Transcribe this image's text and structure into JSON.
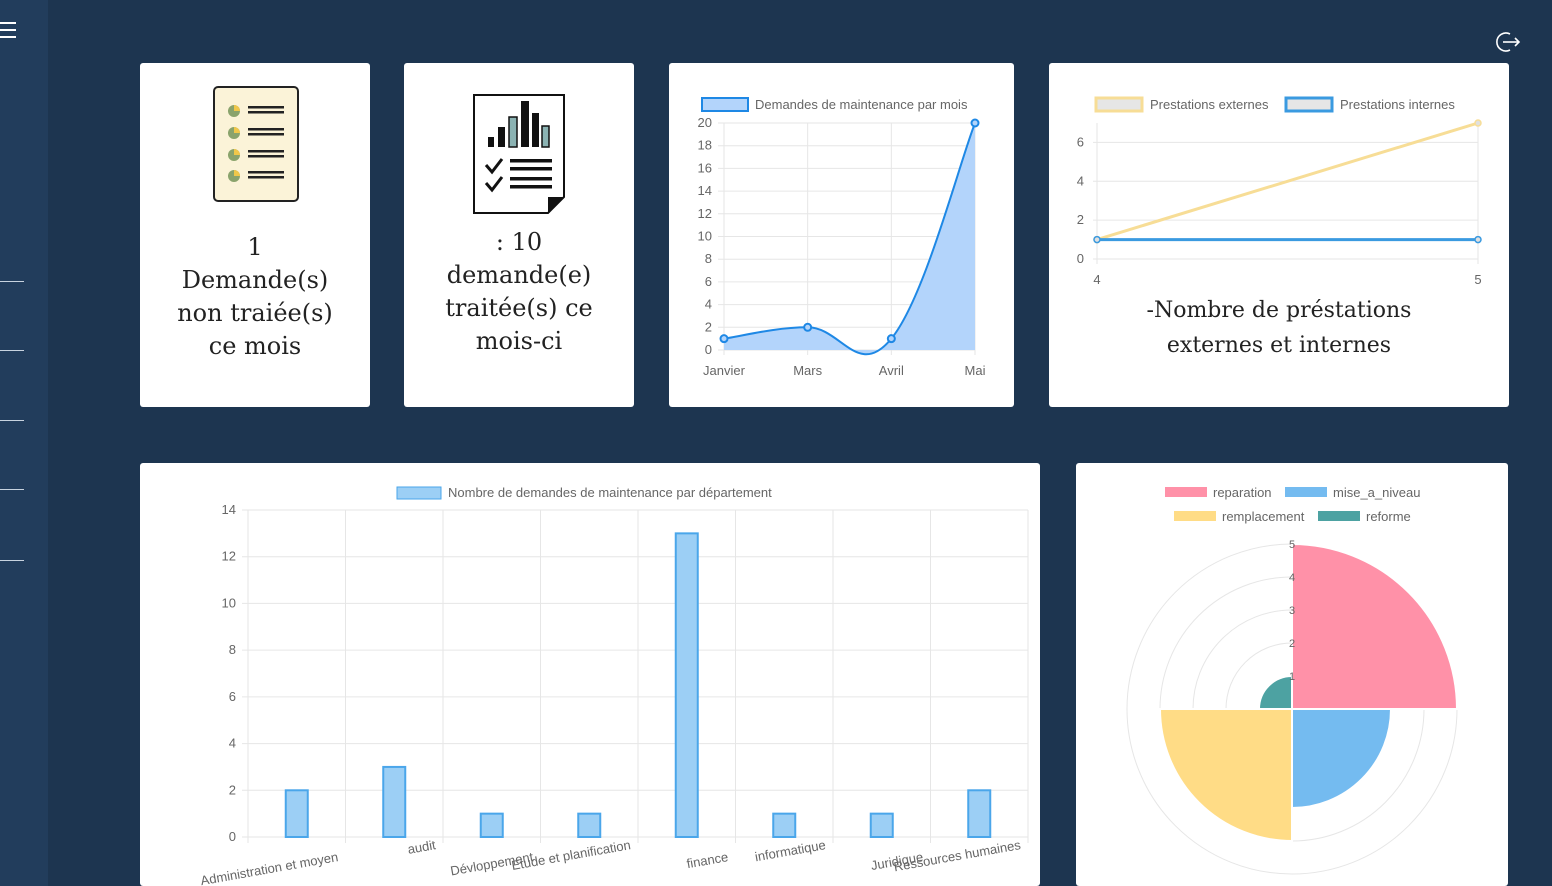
{
  "sidebar": {
    "menu_icon": "hamburger-menu-icon"
  },
  "header": {
    "logout_icon": "logout-icon"
  },
  "cards": {
    "untreated": {
      "icon": "checklist-document-icon",
      "count": "1",
      "line1": "Demande(s)",
      "line2": "non traiée(s)",
      "line3": "ce mois"
    },
    "treated": {
      "icon": "report-chart-document-icon",
      "count": ": 10",
      "line1": "demande(e)",
      "line2": "traitée(s) ce",
      "line3": "mois-ci"
    }
  },
  "prestations_caption": {
    "line1": "-Nombre de préstations",
    "line2": "externes et internes"
  },
  "chart_data": [
    {
      "type": "area",
      "categories": [
        "Janvier",
        "Mars",
        "Avril",
        "Mai"
      ],
      "series": [
        {
          "name": "Demandes de maintenance par mois",
          "values": [
            1,
            2,
            1,
            20
          ]
        }
      ],
      "ylim": [
        0,
        20
      ],
      "yticks": [
        0,
        2,
        4,
        6,
        8,
        10,
        12,
        14,
        16,
        18,
        20
      ],
      "grid": true,
      "legend": "top",
      "colors": {
        "line": "#1e88e5",
        "fill": "#b3d4fb"
      }
    },
    {
      "type": "line",
      "x": [
        4,
        5
      ],
      "series": [
        {
          "name": "Prestations externes",
          "values": [
            1,
            7
          ],
          "color": "#f7dd96"
        },
        {
          "name": "Prestations internes",
          "values": [
            1,
            1
          ],
          "color": "#3a9ae0"
        }
      ],
      "ylim": [
        0,
        7
      ],
      "yticks": [
        0,
        2,
        4,
        6
      ],
      "grid": true,
      "legend": "top"
    },
    {
      "type": "bar",
      "categories": [
        "Administration et moyen",
        "audit",
        "Dévloppement",
        "Etude et planification",
        "finance",
        "informatique",
        "Juridique",
        "Ressources humaines"
      ],
      "series": [
        {
          "name": "Nombre de demandes de maintenance par département",
          "values": [
            2,
            3,
            1,
            1,
            13,
            1,
            1,
            2
          ]
        }
      ],
      "ylim": [
        0,
        14
      ],
      "yticks": [
        0,
        2,
        4,
        6,
        8,
        10,
        12,
        14
      ],
      "grid": true,
      "legend": "top",
      "colors": {
        "fill": "#9ccff5",
        "stroke": "#4aa6ea"
      }
    },
    {
      "type": "polarArea",
      "categories": [
        "reparation",
        "mise_a_niveau",
        "remplacement",
        "reforme"
      ],
      "values": [
        5,
        3,
        4,
        1
      ],
      "rlim": [
        0,
        5
      ],
      "rticks": [
        1,
        2,
        3,
        4,
        5
      ],
      "legend": "top",
      "colors": [
        "#ff91a8",
        "#74bbf0",
        "#ffdc86",
        "#4da2a2"
      ]
    }
  ]
}
